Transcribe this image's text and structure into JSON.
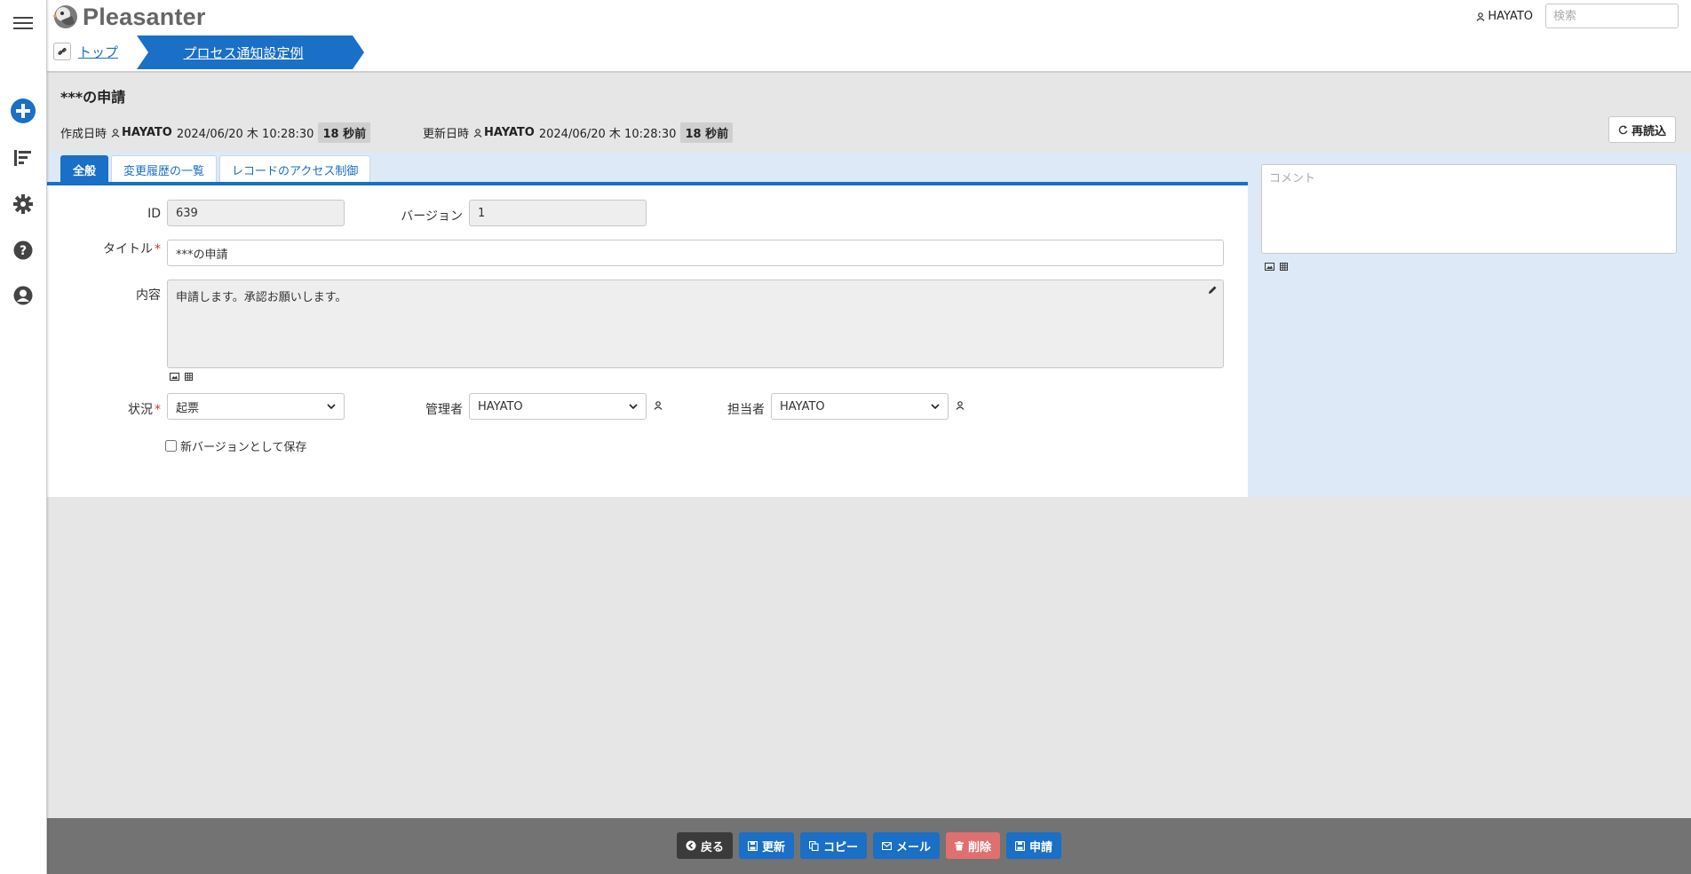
{
  "app": {
    "name": "Pleasanter"
  },
  "header": {
    "user": "HAYATO",
    "search_placeholder": "検索"
  },
  "breadcrumb": {
    "top": "トップ",
    "current": "プロセス通知設定例"
  },
  "record": {
    "title": "***の申請",
    "created_label": "作成日時",
    "created_user": "HAYATO",
    "created_at": "2024/06/20 木 10:28:30",
    "created_ago": "18 秒前",
    "updated_label": "更新日時",
    "updated_user": "HAYATO",
    "updated_at": "2024/06/20 木 10:28:30",
    "updated_ago": "18 秒前",
    "reload_label": "再読込"
  },
  "tabs": [
    {
      "label": "全般",
      "active": true
    },
    {
      "label": "変更履歴の一覧",
      "active": false
    },
    {
      "label": "レコードのアクセス制御",
      "active": false
    }
  ],
  "form": {
    "id_label": "ID",
    "id_value": "639",
    "version_label": "バージョン",
    "version_value": "1",
    "title_label": "タイトル",
    "title_value": "***の申請",
    "content_label": "内容",
    "content_value": "申請します。承認お願いします。",
    "status_label": "状況",
    "status_value": "起票",
    "manager_label": "管理者",
    "manager_value": "HAYATO",
    "owner_label": "担当者",
    "owner_value": "HAYATO",
    "new_version_label": "新バージョンとして保存",
    "required_mark": "*"
  },
  "comment": {
    "placeholder": "コメント"
  },
  "footer": {
    "back": "戻る",
    "update": "更新",
    "copy": "コピー",
    "mail": "メール",
    "delete": "削除",
    "apply": "申請"
  },
  "colors": {
    "accent": "#1a6fc6",
    "delete": "#e06f6f",
    "editor_bg": "#dde9f6"
  }
}
